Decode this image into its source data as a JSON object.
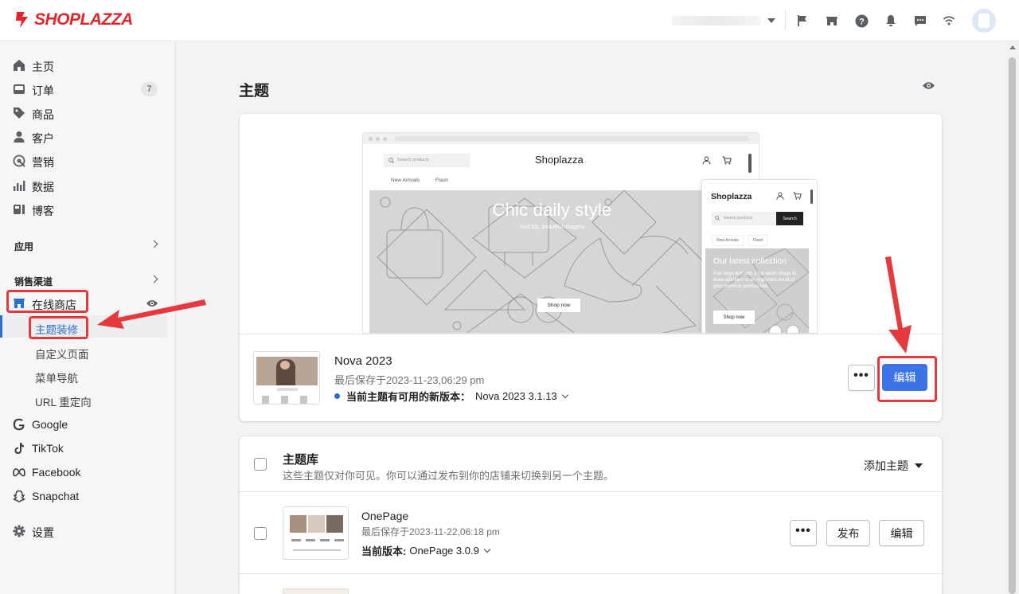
{
  "brand": {
    "name": "SHOPLAZZA",
    "color": "#e0262b"
  },
  "header": {
    "icons": [
      "flag-icon",
      "store-icon",
      "help-icon",
      "bell-icon",
      "message-icon",
      "wifi-icon"
    ]
  },
  "sidebar": {
    "items": [
      {
        "label": "主页",
        "icon": "home-icon"
      },
      {
        "label": "订单",
        "icon": "order-icon",
        "badge": "7"
      },
      {
        "label": "商品",
        "icon": "tag-icon"
      },
      {
        "label": "客户",
        "icon": "person-icon"
      },
      {
        "label": "营销",
        "icon": "marketing-icon"
      },
      {
        "label": "数据",
        "icon": "chart-icon"
      },
      {
        "label": "博客",
        "icon": "blog-icon"
      }
    ],
    "apps_label": "应用",
    "channels_label": "销售渠道",
    "online_store": "在线商店",
    "sub_items": [
      "主题装修",
      "自定义页面",
      "菜单导航",
      "URL 重定向"
    ],
    "channels": [
      {
        "label": "Google",
        "icon": "google-icon"
      },
      {
        "label": "TikTok",
        "icon": "tiktok-icon"
      },
      {
        "label": "Facebook",
        "icon": "meta-icon"
      },
      {
        "label": "Snapchat",
        "icon": "snapchat-icon"
      }
    ],
    "settings": "设置"
  },
  "page": {
    "title": "主题"
  },
  "preview": {
    "desktop": {
      "search": "Search products",
      "brand": "Shoplazza",
      "nav": [
        "New Arrivals",
        "Flash"
      ],
      "hero_title": "Chic daily style",
      "hero_sub": "And big, beautiful imagery",
      "hero_btn": "Shop now"
    },
    "mobile": {
      "brand": "Shoplazza",
      "search": "Search products",
      "search_btn": "Search",
      "tabs": [
        "New Arrivals",
        "Flash"
      ],
      "hero_title": "Our latest collection",
      "hero_text": "Pair large text with a full-width image to draw attention to an important detail of your brand or product line.",
      "hero_btn": "Shop now"
    }
  },
  "current_theme": {
    "name": "Nova 2023",
    "saved": "最后保存于2023-11-23,06:29 pm",
    "update_label": "当前主题有可用的新版本：",
    "update_value": "Nova 2023 3.1.13",
    "edit": "编辑",
    "more": "•••"
  },
  "library": {
    "title": "主题库",
    "desc": "这些主题仅对你可见。你可以通过发布到你的店铺来切换到另一个主题。",
    "add": "添加主题",
    "themes": [
      {
        "name": "OnePage",
        "saved": "最后保存于2023-11-22,06:18 pm",
        "version_label": "当前版本:",
        "version_value": "OnePage 3.0.9",
        "publish": "发布",
        "edit": "编辑",
        "more": "•••"
      }
    ]
  },
  "colors": {
    "primary": "#3b73e8",
    "annotation": "#e6393d",
    "active_bar": "#2c6ecb"
  }
}
